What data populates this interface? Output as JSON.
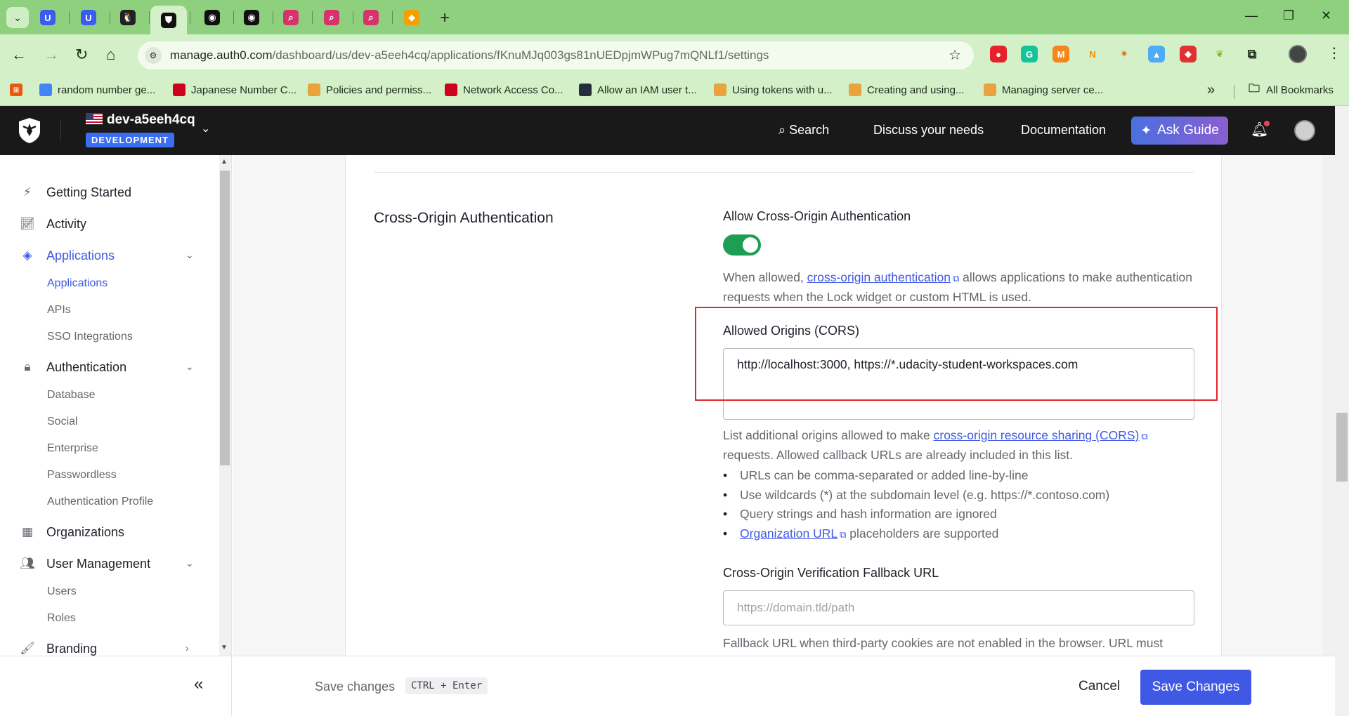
{
  "browser": {
    "tabs": [
      {
        "icon": "udacity-icon",
        "color": "#3a5cf0",
        "glyph": "U"
      },
      {
        "icon": "udacity-icon",
        "color": "#3a5cf0",
        "glyph": "U"
      },
      {
        "icon": "linux-icon",
        "color": "#222222",
        "glyph": "🐧"
      },
      {
        "icon": "auth0-shield-icon",
        "color": "#111111",
        "glyph": "⛊",
        "active": true
      },
      {
        "icon": "github-icon",
        "color": "#111111",
        "glyph": "◉"
      },
      {
        "icon": "github-icon",
        "color": "#111111",
        "glyph": "◉"
      },
      {
        "icon": "jira-icon",
        "color": "#d6336c",
        "glyph": "⌕"
      },
      {
        "icon": "jira-icon",
        "color": "#d6336c",
        "glyph": "⌕"
      },
      {
        "icon": "jira-icon",
        "color": "#d6336c",
        "glyph": "⌕"
      },
      {
        "icon": "aws-box-icon",
        "color": "#f59f00",
        "glyph": "◆"
      }
    ],
    "url_host": "manage.auth0.com",
    "url_path": "/dashboard/us/dev-a5eeh4cq/applications/fKnuMJq003gs81nUEDpjmWPug7mQNLf1/settings",
    "bookmarks": [
      {
        "label": "random number ge...",
        "icon": "google-icon",
        "color": "#4285f4"
      },
      {
        "label": "Japanese Number C...",
        "icon": "japanese-icon",
        "color": "#d0021b"
      },
      {
        "label": "Policies and permiss...",
        "icon": "aws-docs-icon",
        "color": "#e8a33d"
      },
      {
        "label": "Network Access Co...",
        "icon": "shield-icon",
        "color": "#d0021b"
      },
      {
        "label": "Allow an IAM user t...",
        "icon": "aws-icon",
        "color": "#232f3e"
      },
      {
        "label": "Using tokens with u...",
        "icon": "aws-docs-icon",
        "color": "#e8a33d"
      },
      {
        "label": "Creating and using...",
        "icon": "aws-docs-icon",
        "color": "#e8a33d"
      },
      {
        "label": "Managing server ce...",
        "icon": "aws-docs-icon",
        "color": "#e8a33d"
      }
    ],
    "all_bookmarks": "All Bookmarks"
  },
  "header": {
    "tenant": "dev-a5eeh4cq",
    "environment": "DEVELOPMENT",
    "links": {
      "search": "Search",
      "discuss": "Discuss your needs",
      "docs": "Documentation"
    },
    "ask_guide": "Ask Guide"
  },
  "sidebar": {
    "items": [
      {
        "label": "Getting Started",
        "icon": "bolt-icon"
      },
      {
        "label": "Activity",
        "icon": "activity-icon"
      },
      {
        "label": "Applications",
        "icon": "layers-icon"
      },
      {
        "label": "Authentication",
        "icon": "lock-icon"
      },
      {
        "label": "Organizations",
        "icon": "building-icon"
      },
      {
        "label": "User Management",
        "icon": "users-icon"
      },
      {
        "label": "Branding",
        "icon": "brush-icon"
      }
    ],
    "applications_sub": [
      "Applications",
      "APIs",
      "SSO Integrations"
    ],
    "authentication_sub": [
      "Database",
      "Social",
      "Enterprise",
      "Passwordless",
      "Authentication Profile"
    ],
    "user_management_sub": [
      "Users",
      "Roles"
    ]
  },
  "content": {
    "section_title": "Cross-Origin Authentication",
    "allow_label": "Allow Cross-Origin Authentication",
    "allow_enabled": true,
    "allow_help_pre": "When allowed, ",
    "allow_help_link": "cross-origin authentication",
    "allow_help_post": " allows applications to make authentication requests when the Lock widget or custom HTML is used.",
    "origins_label": "Allowed Origins (CORS)",
    "origins_value": "http://localhost:3000, https://*.udacity-student-workspaces.com",
    "origins_help_pre": "List additional origins allowed to make ",
    "origins_help_link": "cross-origin resource sharing (CORS)",
    "origins_help_post": " requests. Allowed callback URLs are already included in this list.",
    "bullets": [
      "URLs can be comma-separated or added line-by-line",
      "Use wildcards (*) at the subdomain level (e.g. https://*.contoso.com)",
      "Query strings and hash information are ignored"
    ],
    "bullet_link": "Organization URL",
    "bullet_link_post": " placeholders are supported",
    "fallback_label": "Cross-Origin Verification Fallback URL",
    "fallback_placeholder": "https://domain.tld/path",
    "fallback_help": "Fallback URL when third-party cookies are not enabled in the browser. URL must"
  },
  "savebar": {
    "text": "Save changes",
    "shortcut": "CTRL + Enter",
    "cancel": "Cancel",
    "save": "Save Changes"
  },
  "colors": {
    "accent": "#3f59e4",
    "toggle_on": "#1f9d55",
    "highlight": "#e2262b"
  }
}
